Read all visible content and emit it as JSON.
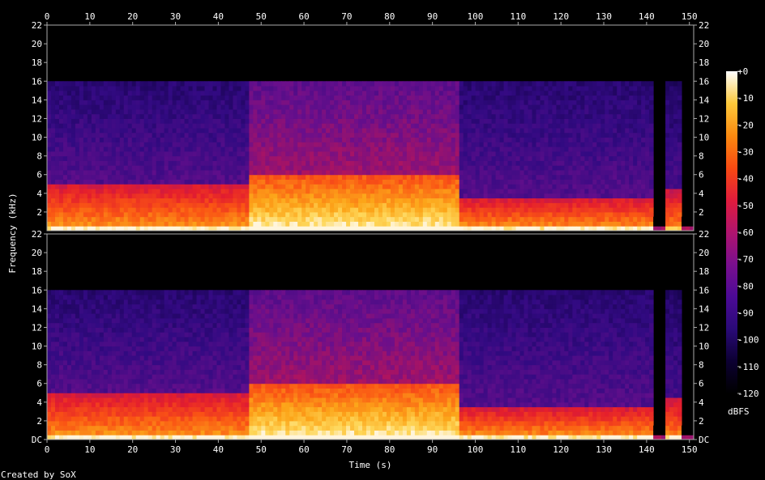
{
  "chart_data": {
    "type": "heatmap",
    "subtype": "spectrogram",
    "channels": 2,
    "xlabel": "Time (s)",
    "ylabel": "Frequency (kHz)",
    "xlim": [
      0,
      151
    ],
    "ylim": [
      0,
      22
    ],
    "x_ticks": [
      0,
      10,
      20,
      30,
      40,
      50,
      60,
      70,
      80,
      90,
      100,
      110,
      120,
      130,
      140,
      150
    ],
    "y_ticks_top": [
      "2",
      "4",
      "6",
      "8",
      "10",
      "12",
      "14",
      "16",
      "18",
      "20",
      "22"
    ],
    "y_ticks_bottom": [
      "DC",
      "2",
      "4",
      "6",
      "8",
      "10",
      "12",
      "14",
      "16",
      "18",
      "20",
      "22"
    ],
    "y_tick_values": [
      0,
      2,
      4,
      6,
      8,
      10,
      12,
      14,
      16,
      18,
      20,
      22
    ],
    "colorbar": {
      "label": "dBFS",
      "ticks": [
        "+0",
        "-10",
        "-20",
        "-30",
        "-40",
        "-50",
        "-60",
        "-70",
        "-80",
        "-90",
        "-100",
        "-110",
        "-120"
      ],
      "tick_values": [
        0,
        -10,
        -20,
        -30,
        -40,
        -50,
        -60,
        -70,
        -80,
        -90,
        -100,
        -110,
        -120
      ],
      "range": [
        -120,
        0
      ]
    },
    "cutoff_khz": 16,
    "sections": [
      {
        "t0": 0,
        "t1": 47.5,
        "bright_top_khz": 5.0,
        "energy": "medium"
      },
      {
        "t0": 47.5,
        "t1": 96.5,
        "bright_top_khz": 6.0,
        "energy": "high"
      },
      {
        "t0": 96.5,
        "t1": 141.5,
        "bright_top_khz": 3.5,
        "energy": "medium"
      },
      {
        "t0": 141.5,
        "t1": 144.5,
        "bright_top_khz": 0.5,
        "energy": "low"
      },
      {
        "t0": 144.5,
        "t1": 148.5,
        "bright_top_khz": 4.5,
        "energy": "medium-decay"
      },
      {
        "t0": 148.5,
        "t1": 151,
        "bright_top_khz": 0.5,
        "energy": "low"
      }
    ]
  },
  "footer": {
    "credit": "Created by SoX"
  }
}
